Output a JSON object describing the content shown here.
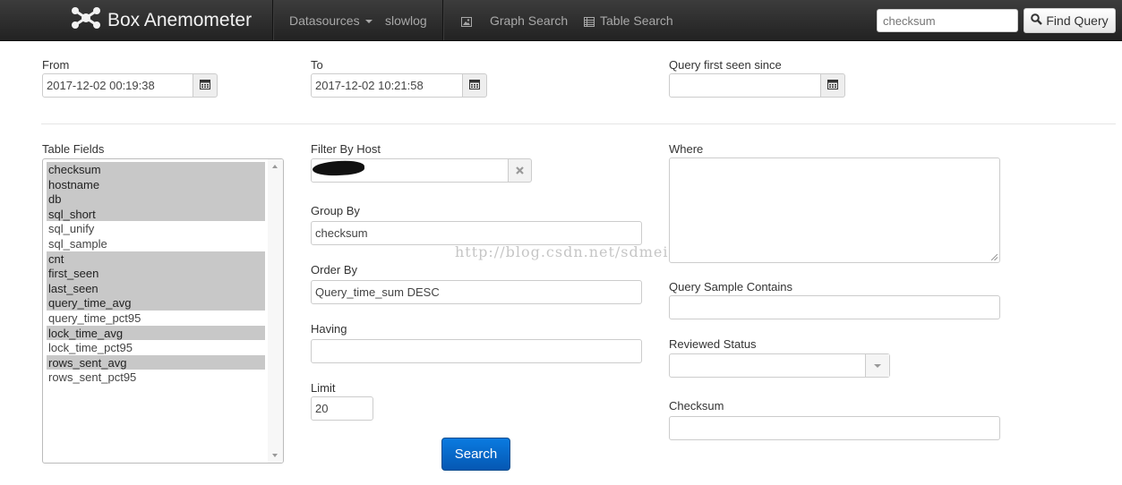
{
  "navbar": {
    "brand": "Box Anemometer",
    "datasources": "Datasources",
    "slowlog": "slowlog",
    "graph_search": "Graph Search",
    "table_search": "Table Search",
    "search_placeholder": "checksum",
    "find_query": "Find Query"
  },
  "form": {
    "from_label": "From",
    "from_value": "2017-12-02 00:19:38",
    "to_label": "To",
    "to_value": "2017-12-02 10:21:58",
    "first_seen_label": "Query first seen since",
    "first_seen_value": "",
    "table_fields_label": "Table Fields",
    "table_fields": [
      {
        "name": "checksum",
        "selected": true
      },
      {
        "name": "hostname",
        "selected": true
      },
      {
        "name": "db",
        "selected": true
      },
      {
        "name": "sql_short",
        "selected": true
      },
      {
        "name": "sql_unify",
        "selected": false
      },
      {
        "name": "sql_sample",
        "selected": false
      },
      {
        "name": "cnt",
        "selected": true
      },
      {
        "name": "first_seen",
        "selected": true
      },
      {
        "name": "last_seen",
        "selected": true
      },
      {
        "name": "query_time_avg",
        "selected": true
      },
      {
        "name": "query_time_pct95",
        "selected": false
      },
      {
        "name": "lock_time_avg",
        "selected": true
      },
      {
        "name": "lock_time_pct95",
        "selected": false
      },
      {
        "name": "rows_sent_avg",
        "selected": true
      },
      {
        "name": "rows_sent_pct95",
        "selected": false
      }
    ],
    "filter_host_label": "Filter By Host",
    "group_by_label": "Group By",
    "group_by_value": "checksum",
    "order_by_label": "Order By",
    "order_by_value": "Query_time_sum DESC",
    "having_label": "Having",
    "having_value": "",
    "limit_label": "Limit",
    "limit_value": "20",
    "search_button": "Search",
    "where_label": "Where",
    "where_value": "",
    "sample_contains_label": "Query Sample Contains",
    "reviewed_status_label": "Reviewed Status",
    "checksum_label": "Checksum"
  },
  "watermark": "http://blog.csdn.net/sdmei",
  "colors": {
    "navbar": "#222222",
    "selected_row": "#c8c8c8",
    "primary_button": "#0a6fd6"
  }
}
